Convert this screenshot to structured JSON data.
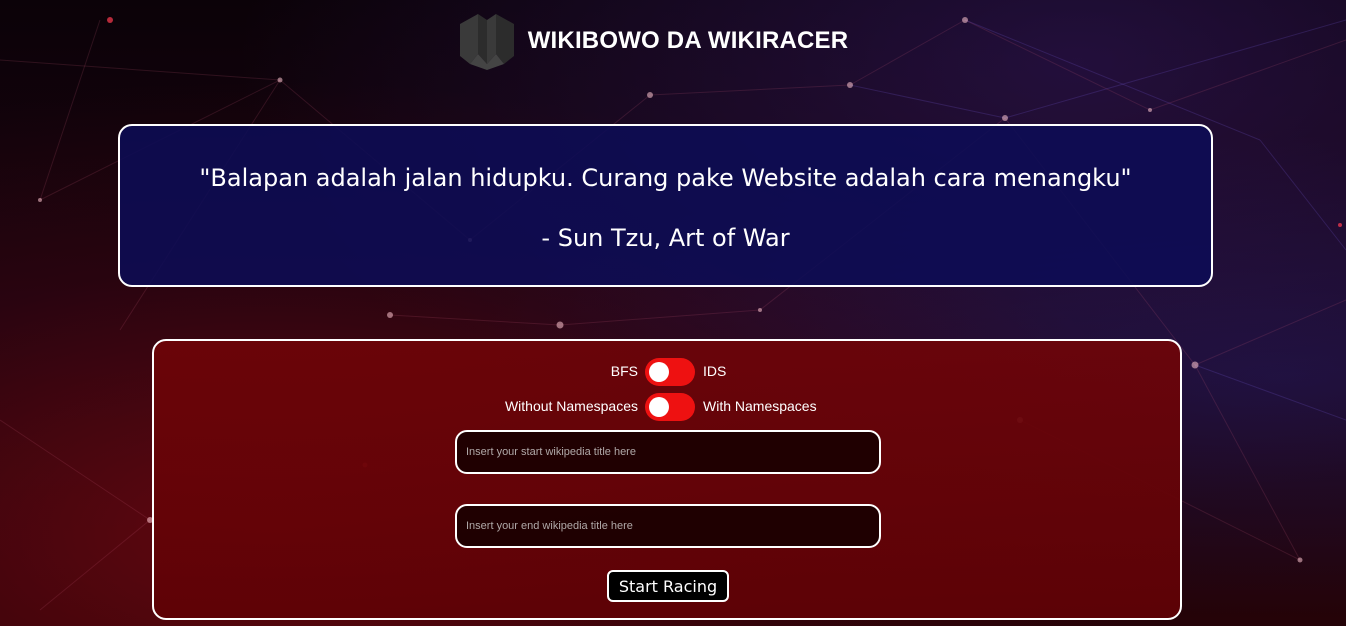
{
  "header": {
    "logo_icon": "w-shield-logo-icon",
    "title": "WIKIBOWO DA WIKIRACER"
  },
  "quote": {
    "text": "\"Balapan adalah jalan hidupku. Curang pake Website adalah cara menangku\"",
    "author": "- Sun Tzu, Art of War"
  },
  "form": {
    "algorithm_toggle": {
      "left_label": "BFS",
      "right_label": "IDS",
      "selected": "BFS"
    },
    "namespace_toggle": {
      "left_label": "Without Namespaces",
      "right_label": "With Namespaces",
      "selected": "Without Namespaces"
    },
    "start_input": {
      "value": "",
      "placeholder": "Insert your start wikipedia title here"
    },
    "end_input": {
      "value": "",
      "placeholder": "Insert your end wikipedia title here"
    },
    "submit_label": "Start Racing"
  },
  "colors": {
    "quote_bg": "#0c0c55",
    "form_bg": "#6e0408",
    "toggle_on": "#ee1111",
    "border": "#ffffff"
  }
}
